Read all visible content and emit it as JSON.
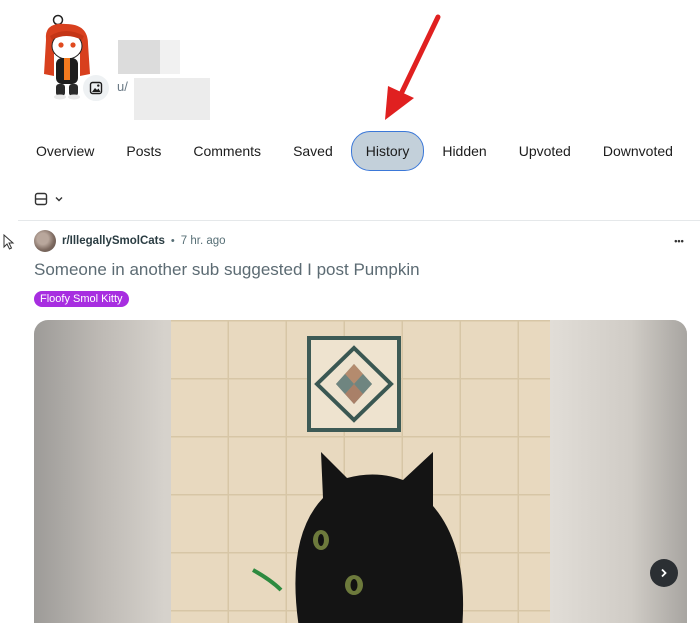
{
  "profile": {
    "username_prefix": "u/"
  },
  "tabs": [
    {
      "label": "Overview"
    },
    {
      "label": "Posts"
    },
    {
      "label": "Comments"
    },
    {
      "label": "Saved"
    },
    {
      "label": "History",
      "active": true
    },
    {
      "label": "Hidden"
    },
    {
      "label": "Upvoted"
    },
    {
      "label": "Downvoted"
    }
  ],
  "post": {
    "subreddit": "r/IllegallySmolCats",
    "separator": "•",
    "time": "7 hr. ago",
    "title": "Someone in another sub suggested I post Pumpkin",
    "flair": "Floofy Smol Kitty",
    "more_label": "•••"
  },
  "colors": {
    "active_tab_bg": "#c3d0da",
    "active_tab_border": "#3b78d8",
    "flair_bg": "#a72ee0",
    "annotation_arrow": "#e02020"
  },
  "icons": {
    "avatar": "snoo-avatar",
    "avatar_edit": "image-edit-icon",
    "view": "card-view-icon",
    "chevron": "chevron-down-icon",
    "more": "ellipsis-icon",
    "next": "chevron-right-icon",
    "cursor": "mouse-cursor-icon"
  }
}
